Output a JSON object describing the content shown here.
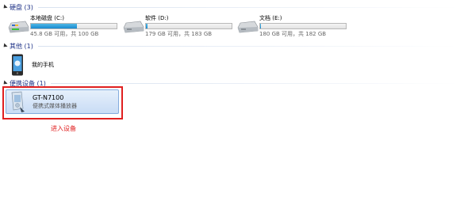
{
  "groups": {
    "hard_disks": "硬盘 (3)",
    "other": "其他 (1)",
    "portable": "便携设备 (1)"
  },
  "drives": [
    {
      "name": "本地磁盘 (C:)",
      "free_text": "45.8 GB 可用，共 100 GB",
      "used_fraction": 0.54,
      "fill_color": "#26a0da"
    },
    {
      "name": "软件 (D:)",
      "free_text": "179 GB 可用，共 183 GB",
      "used_fraction": 0.02,
      "fill_color": "#26a0da"
    },
    {
      "name": "文档 (E:)",
      "free_text": "180 GB 可用，共 182 GB",
      "used_fraction": 0.01,
      "fill_color": "#26a0da"
    }
  ],
  "phone": {
    "name": "我的手机"
  },
  "device": {
    "name": "GT-N7100",
    "description": "便携式媒体播放器"
  },
  "annotation": "进入设备",
  "colors": {
    "highlight": "#e02020",
    "group_header": "#1e3287"
  }
}
